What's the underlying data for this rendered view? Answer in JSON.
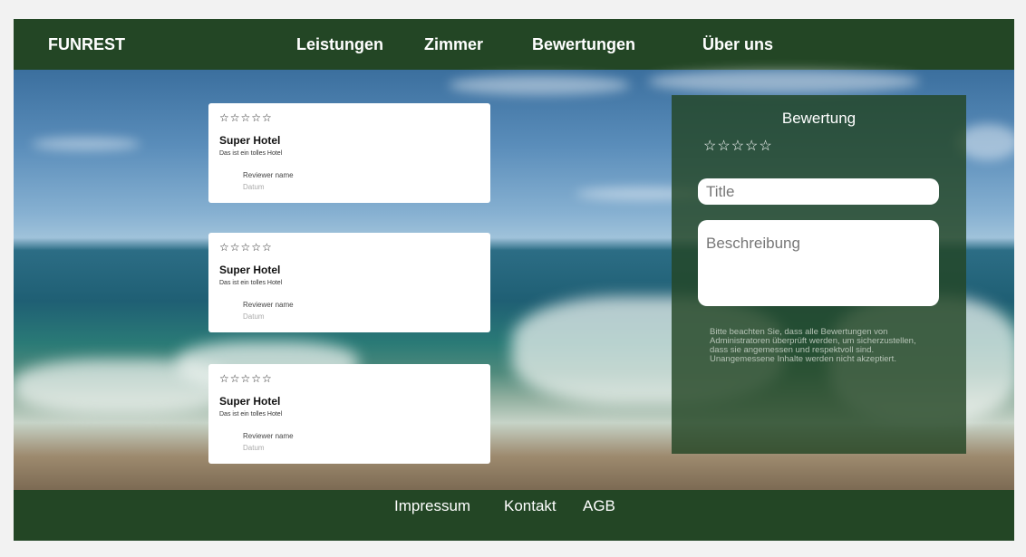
{
  "nav": {
    "brand": "FUNREST",
    "links": [
      "Leistungen",
      "Zimmer",
      "Bewertungen",
      "Über uns"
    ]
  },
  "reviews": [
    {
      "stars": "☆☆☆☆☆",
      "title": "Super Hotel",
      "description": "Das ist ein tolles Hotel",
      "reviewer": "Reviewer name",
      "date": "Datum"
    },
    {
      "stars": "☆☆☆☆☆",
      "title": "Super Hotel",
      "description": "Das ist ein tolles Hotel",
      "reviewer": "Reviewer name",
      "date": "Datum"
    },
    {
      "stars": "☆☆☆☆☆",
      "title": "Super Hotel",
      "description": "Das ist ein tolles Hotel",
      "reviewer": "Reviewer name",
      "date": "Datum"
    }
  ],
  "form": {
    "title": "Bewertung",
    "stars": "☆☆☆☆☆",
    "title_placeholder": "Title",
    "description_placeholder": "Beschreibung",
    "note": "Bitte beachten Sie, dass alle Bewertungen von Administratoren überprüft werden, um sicherzustellen, dass sie angemessen und respektvoll sind. Unangemessene Inhalte werden nicht akzeptiert."
  },
  "footer": {
    "links": [
      "Impressum",
      "Kontakt",
      "AGB"
    ]
  },
  "colors": {
    "primary": "#234625",
    "panel": "#2b4f2d"
  },
  "icons": {
    "star": "star-outline-icon"
  }
}
